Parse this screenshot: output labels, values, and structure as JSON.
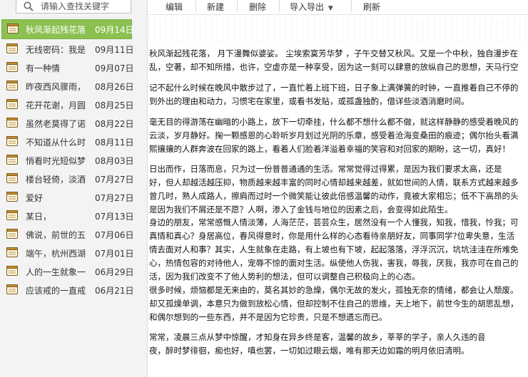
{
  "search": {
    "placeholder": "请输入查找关键字"
  },
  "toolbar": {
    "edit": "编辑",
    "new": "新建",
    "delete": "删除",
    "import_export": "导入导出",
    "import_export_arrow": "▼",
    "refresh": "刷新"
  },
  "notes": [
    {
      "title": "秋风渐起残花落",
      "date": "09月14日"
    },
    {
      "title": "无线密码：我是",
      "date": "09月11日"
    },
    {
      "title": "有一种情",
      "date": "09月07日"
    },
    {
      "title": "昨夜西风骤雨，",
      "date": "08月26日"
    },
    {
      "title": "花开花谢，月圆",
      "date": "08月25日"
    },
    {
      "title": "虽然老莫得了诺",
      "date": "08月22日"
    },
    {
      "title": "不知道从什么时",
      "date": "08月11日"
    },
    {
      "title": "悄看时光短似梦",
      "date": "08月03日"
    },
    {
      "title": "楼台轻倚，淡酒",
      "date": "07月27日"
    },
    {
      "title": "爱好",
      "date": "07月27日"
    },
    {
      "title": "某日，",
      "date": "07月13日"
    },
    {
      "title": "佛说，前世的五",
      "date": "07月06日"
    },
    {
      "title": "端午，杭州西湖",
      "date": "07月01日"
    },
    {
      "title": "人的一生就象一",
      "date": "06月29日"
    },
    {
      "title": "应该戒的一直戒",
      "date": "06月21日"
    }
  ],
  "content": {
    "paragraphs": [
      [
        "秋风渐起残花落， 月下漫舞似婆娑。 尘埃索寞芳华梦 ，子午交替又秋风。又是一个中秋，独自漫步在",
        "乱，空著，却不知所措，也许，空虚亦是一种享受，因为这一刻可以肆意的放纵自己的思想，天马行空"
      ],
      [
        "记不起什么时候在晚风中散步过了，一直忙着上班下班，日子象上满弹簧的时钟，一直推着自己不停的",
        "到外出的理由和动力，习惯宅在家里，或看书发贴，或孤盏独酌，借详些淡酒消磨时间。"
      ],
      [
        "毫无目的得游荡在幽暗的小路上，放下一切牵挂，什么都不想什么都不做，就这样静静的感受着晚风的",
        "云淡，岁月静好。掬一颗感恩的心聆听岁月划过光阴的乐章，感受着沧海变桑田的痕迹；偶尔抬头看满",
        "熙攘攘的人群奔波在回家的路上，看着人们脸着洋溢着幸福的笑容和对回家的期盼，这一切，真好！"
      ],
      [
        "     日出而作，日落而息，只为过一份普普通通的生活。常常觉得过得累，是因为我们要求太高，还是",
        "好，但人却越活越压抑，物质越来越丰富的同时心情却越来越差，就如世间的人情，联系方式越来越多",
        "曾几时，熟人成路人，擦肩而过时一个微笑能让彼此倍感温馨的动作，竟被大家相忘；低不下高昂的头",
        "是因为我们不屑还是不愿？人啊，渗入了金钱与地位的因素之后，会变得如此陌生。"
      ],
      [
        "身边的朋友，常常感慨人情淡薄，人海茫茫，芸芸众生，居然没有一个人懂我，知我，惜我，怜我；可",
        "真情和真心？身居高位，春风得意时，你是用什么样的心态看待亲朋好友，同事同学?位卑失意，生活",
        "情去面对人和事？其实，人生就象在走路，有上坡也有下坡，起起落落，浮浮沉沉，坑坑洼洼在所难免",
        "心，热情包容的对待他人，宠辱不惊的面对生活。纵使他人伤我，害我，辱我，厌我，我亦可在自己的",
        "活，因为我们改变不了他人势利的想法，但可以调整自己积极向上的心态。"
      ],
      [
        "很多时候，烦恼都是无来由的，莫名其妙的急燥，偶尔无故的发火，孤独无奈的情绪，都会让人颓废。",
        "却又孤燥单调，本意只为做到放松心情，但却控制不住自己的思维，天上地下，前世今生的胡思乱想，",
        "和偶尔想到的一些东西，并不是因为它珍贵，只是不想遗忘而已。"
      ],
      [
        "        常常，凌晨三点从梦中惊醒，才知身在异乡终是客，温馨的故乡，莘莘的学子，亲人久违的音",
        "夜，醉时梦徘徊，痴也好，嗔也罢，一切如过眼云烟，唯有那天边如霜的明月依旧清明。"
      ]
    ]
  }
}
